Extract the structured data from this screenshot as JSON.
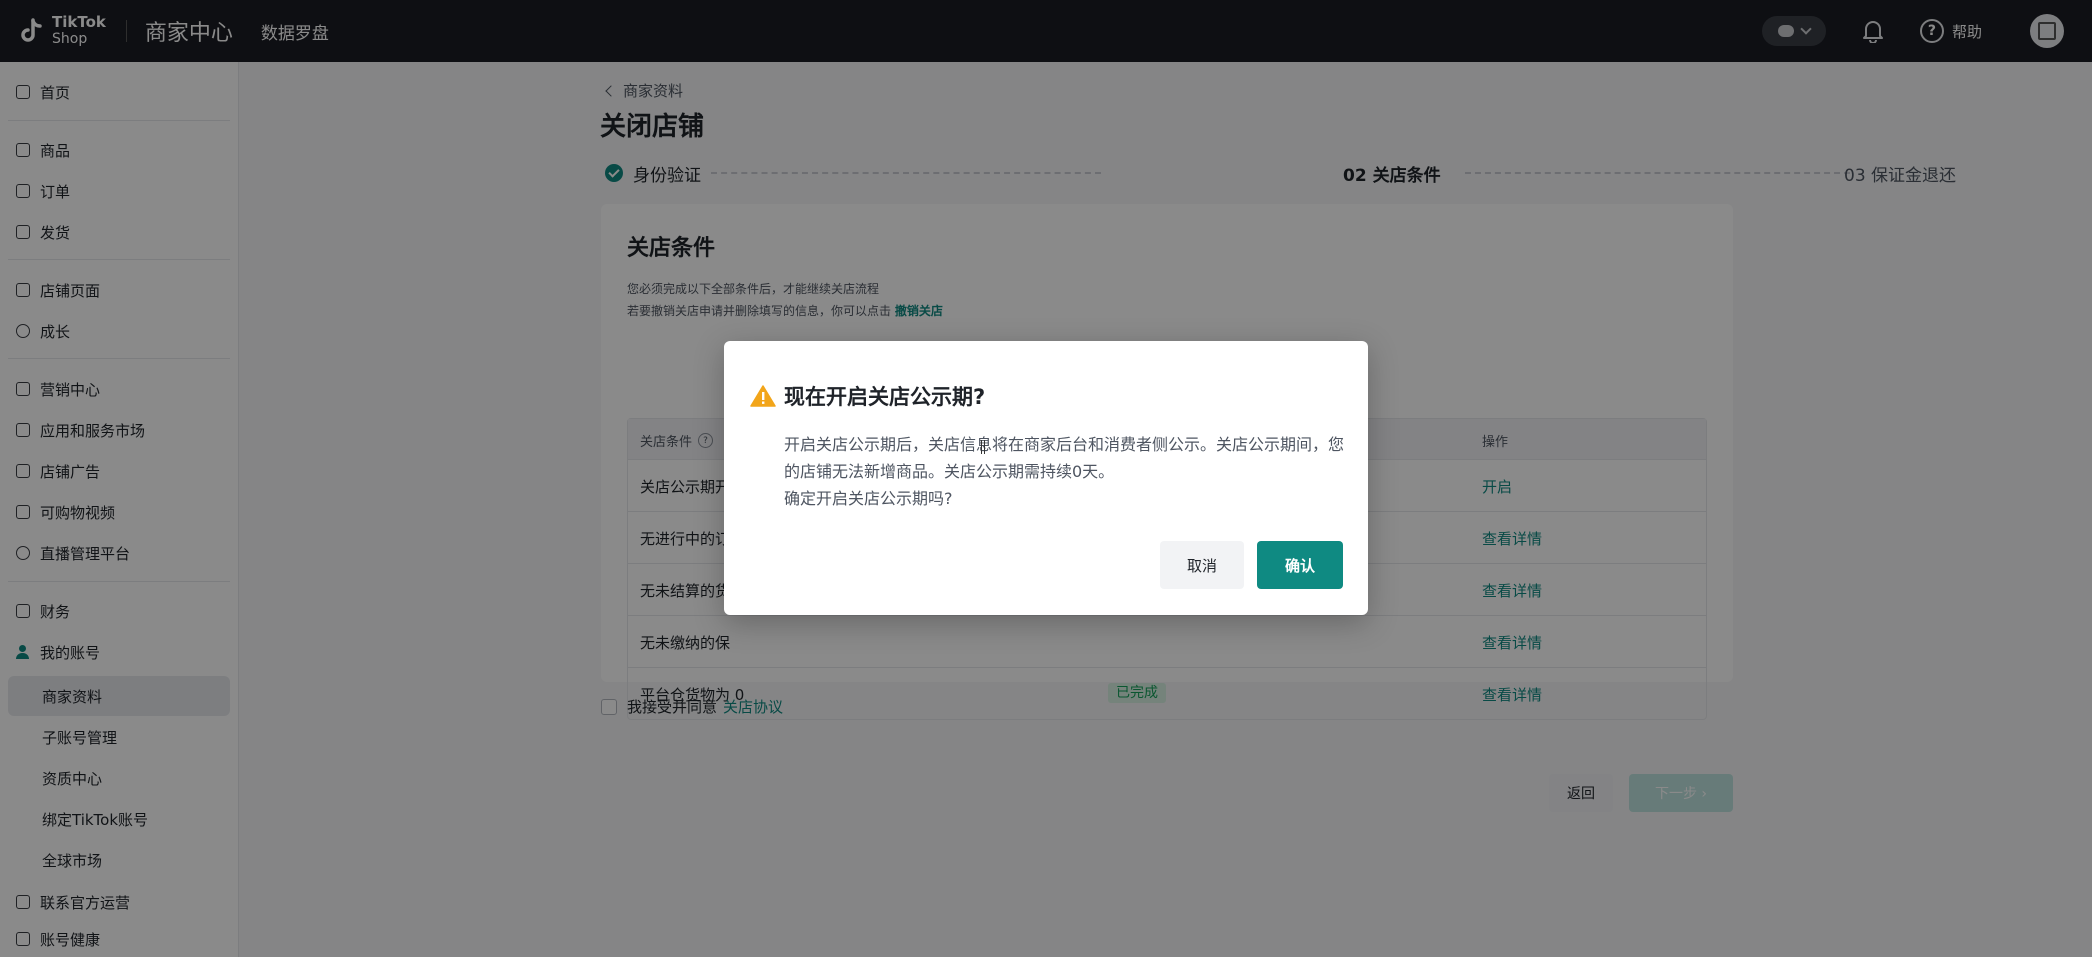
{
  "topbar": {
    "logo_line1": "TikTok",
    "logo_line2": "Shop",
    "title": "商家中心",
    "subtitle": "数据罗盘",
    "help_label": "帮助"
  },
  "sidebar": {
    "items": [
      {
        "label": "首页"
      },
      {
        "label": "商品"
      },
      {
        "label": "订单"
      },
      {
        "label": "发货"
      },
      {
        "label": "店铺页面"
      },
      {
        "label": "成长"
      },
      {
        "label": "营销中心"
      },
      {
        "label": "应用和服务市场"
      },
      {
        "label": "店铺广告"
      },
      {
        "label": "可购物视频"
      },
      {
        "label": "直播管理平台"
      },
      {
        "label": "财务"
      },
      {
        "label": "我的账号"
      },
      {
        "label": "联系官方运营"
      }
    ],
    "account_sub": [
      "商家资料",
      "子账号管理",
      "资质中心",
      "绑定TikTok账号",
      "全球市场"
    ],
    "partial_item": "账号健康"
  },
  "main": {
    "breadcrumb": "商家资料",
    "page_title": "关闭店铺",
    "steps": [
      "身份验证",
      "02  关店条件",
      "03  保证金退还"
    ],
    "card": {
      "title": "关店条件",
      "note1": "您必须完成以下全部条件后，才能继续关店流程",
      "note2_prefix": "若要撤销关店申请并删除填写的信息，你可以点击",
      "note2_link": "撤销关店",
      "table": {
        "headers": [
          "关店条件",
          "操作"
        ],
        "rows": [
          {
            "condition": "关店公示期开",
            "status": "",
            "action": "开启"
          },
          {
            "condition": "无进行中的订",
            "status": "",
            "action": "查看详情"
          },
          {
            "condition": "无未结算的货",
            "status": "",
            "action": "查看详情"
          },
          {
            "condition": "无未缴纳的保",
            "status": "",
            "action": "查看详情"
          },
          {
            "condition": "平台仓货物为 0",
            "status": "已完成",
            "action": "查看详情"
          }
        ]
      }
    },
    "agree_text": "我接受并同意",
    "agree_link": "关店协议",
    "back_label": "返回",
    "next_label": "下一步"
  },
  "modal": {
    "title": "现在开启关店公示期?",
    "body_line1": "开启关店公示期后，关店信息将在商家后台和消费者侧公示。关店公示期间，您的店铺无法新增商品。关店公示期需持续0天。",
    "body_line2": "确定开启关店公示期吗?",
    "cancel_label": "取消",
    "confirm_label": "确认"
  },
  "colors": {
    "accent": "#0f8a82",
    "topbar": "#1b1d24",
    "warning": "#f2a51a",
    "fab": "#4338c4"
  }
}
